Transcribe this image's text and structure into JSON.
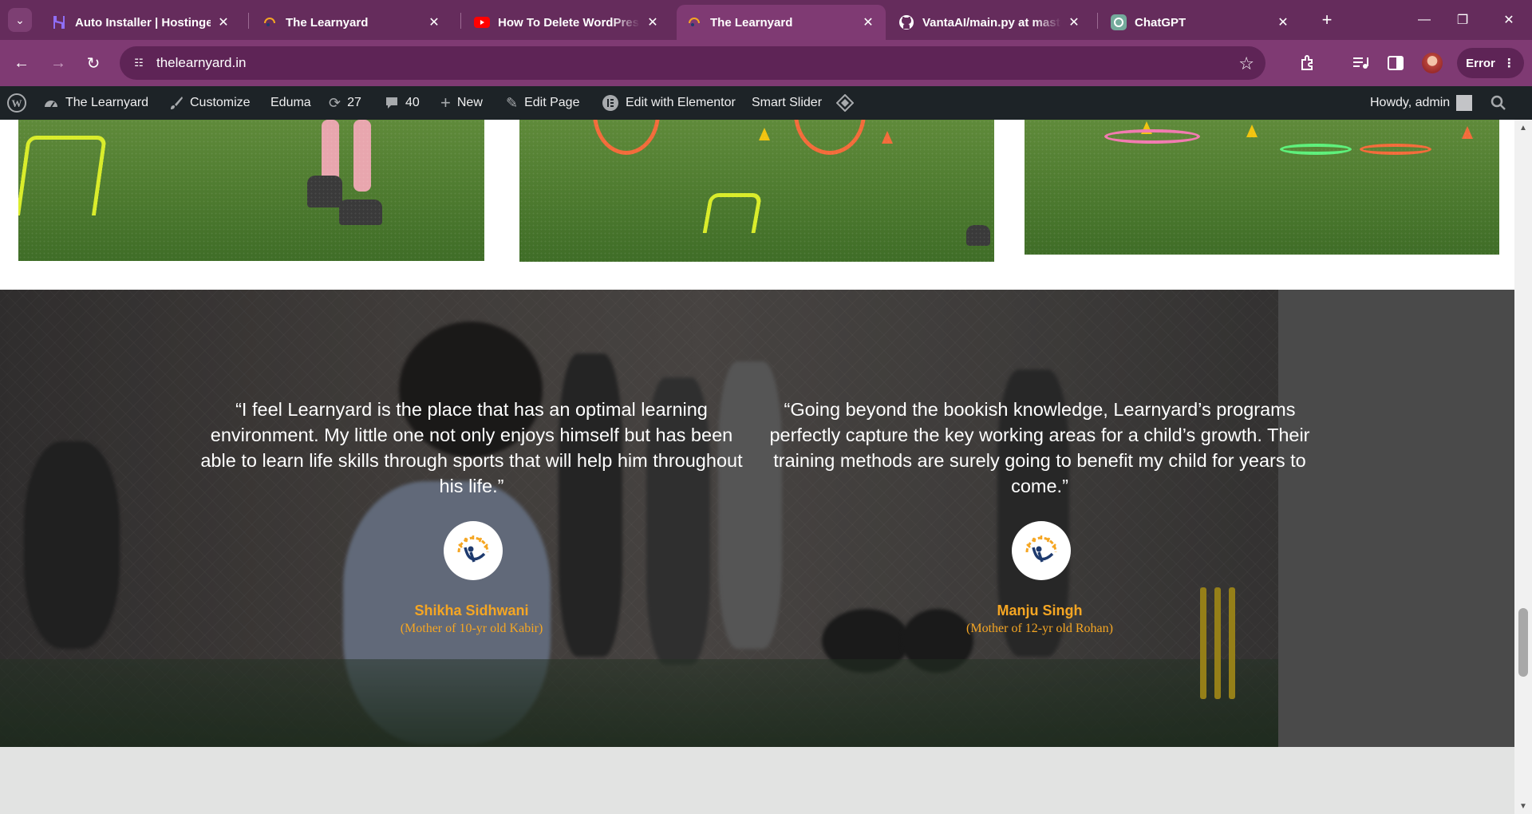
{
  "browser": {
    "tabs": [
      {
        "title": "Auto Installer | Hostinger",
        "icon": "hostinger-icon",
        "active": false
      },
      {
        "title": "The Learnyard",
        "icon": "learnyard-icon",
        "active": false
      },
      {
        "title": "How To Delete WordPress",
        "icon": "youtube-icon",
        "active": false
      },
      {
        "title": "The Learnyard",
        "icon": "learnyard-icon",
        "active": true
      },
      {
        "title": "VantaAI/main.py at master",
        "icon": "github-icon",
        "active": false
      },
      {
        "title": "ChatGPT",
        "icon": "chatgpt-icon",
        "active": false
      }
    ],
    "url": "thelearnyard.in",
    "error_label": "Error",
    "accent_color": "#7f3a73"
  },
  "adminbar": {
    "site_name": "The Learnyard",
    "customize": "Customize",
    "theme": "Eduma",
    "updates_count": "27",
    "comments_count": "40",
    "new_label": "New",
    "edit_page": "Edit Page",
    "edit_elementor": "Edit with Elementor",
    "smart_slider": "Smart Slider",
    "howdy": "Howdy, admin"
  },
  "testimonials": [
    {
      "quote": "“I feel Learnyard is the place that has an optimal learning environment. My little one not only enjoys himself but has been able to learn life skills through sports that will help him throughout his life.”",
      "name": "Shikha Sidhwani",
      "role": "(Mother of 10-yr old Kabir)"
    },
    {
      "quote": "“Going beyond the bookish knowledge, Learnyard’s programs perfectly capture the key working areas for a child’s growth. Their training methods are surely going to benefit my child for years to come.”",
      "name": "Manju Singh",
      "role": "(Mother of 12-yr old Rohan)"
    }
  ],
  "colors": {
    "name_color": "#f5a623",
    "adminbar_bg": "#1d2327"
  }
}
